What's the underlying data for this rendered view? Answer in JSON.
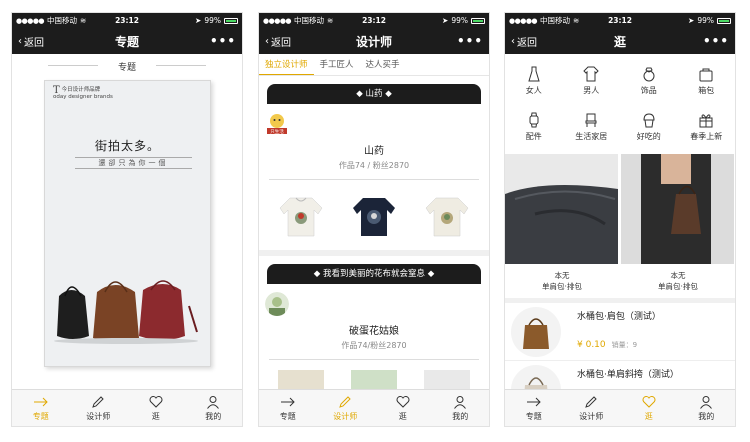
{
  "status": {
    "carrier": "中国移动",
    "time": "23:12",
    "battery": "99%"
  },
  "colors": {
    "accent": "#e0a800",
    "navbar": "#1c1c1c"
  },
  "tabbar": {
    "items": [
      {
        "label": "专题",
        "icon": "arrow-right-icon"
      },
      {
        "label": "设计师",
        "icon": "pencil-icon"
      },
      {
        "label": "逛",
        "icon": "heart-icon"
      },
      {
        "label": "我的",
        "icon": "person-icon"
      }
    ]
  },
  "screen1": {
    "back_label": "返回",
    "title": "专题",
    "more": "•••",
    "section_heading": "专题",
    "cover": {
      "brand_line1": "今日设计师品牌",
      "brand_line2": "oday designer brands",
      "brand_initial": "T",
      "headline": "街拍太多。",
      "subline": "還卻只為你一個"
    }
  },
  "screen2": {
    "back_label": "返回",
    "title": "设计师",
    "more": "•••",
    "tabs": [
      "独立设计师",
      "手工匠人",
      "达人买手"
    ],
    "cards": [
      {
        "banner": "◆ 山药 ◆",
        "name": "山药",
        "stats": "作品74 / 粉丝2870",
        "avatar_text": "只生活"
      },
      {
        "banner": "◆ 我看到美丽的花布就会窒息 ◆",
        "name": "破蛋花姑娘",
        "stats": "作品74/粉丝2870"
      }
    ]
  },
  "screen3": {
    "back_label": "返回",
    "title": "逛",
    "more": "•••",
    "categories": [
      {
        "label": "女人",
        "icon": "dress-icon"
      },
      {
        "label": "男人",
        "icon": "shirt-icon"
      },
      {
        "label": "饰品",
        "icon": "ring-icon"
      },
      {
        "label": "箱包",
        "icon": "bag-icon"
      },
      {
        "label": "配件",
        "icon": "watch-icon"
      },
      {
        "label": "生活家居",
        "icon": "chair-icon"
      },
      {
        "label": "好吃的",
        "icon": "cupcake-icon"
      },
      {
        "label": "春季上新",
        "icon": "gift-icon"
      }
    ],
    "featured": [
      {
        "line1": "本无",
        "line2": "单肩包·排包"
      },
      {
        "line1": "本无",
        "line2": "单肩包·排包"
      }
    ],
    "products": [
      {
        "name": "水桶包·肩包（测试）",
        "price": "¥ 0.10",
        "sales": "销量：9"
      },
      {
        "name": "水桶包·单肩斜挎（测试）",
        "price": "",
        "sales": ""
      }
    ]
  }
}
